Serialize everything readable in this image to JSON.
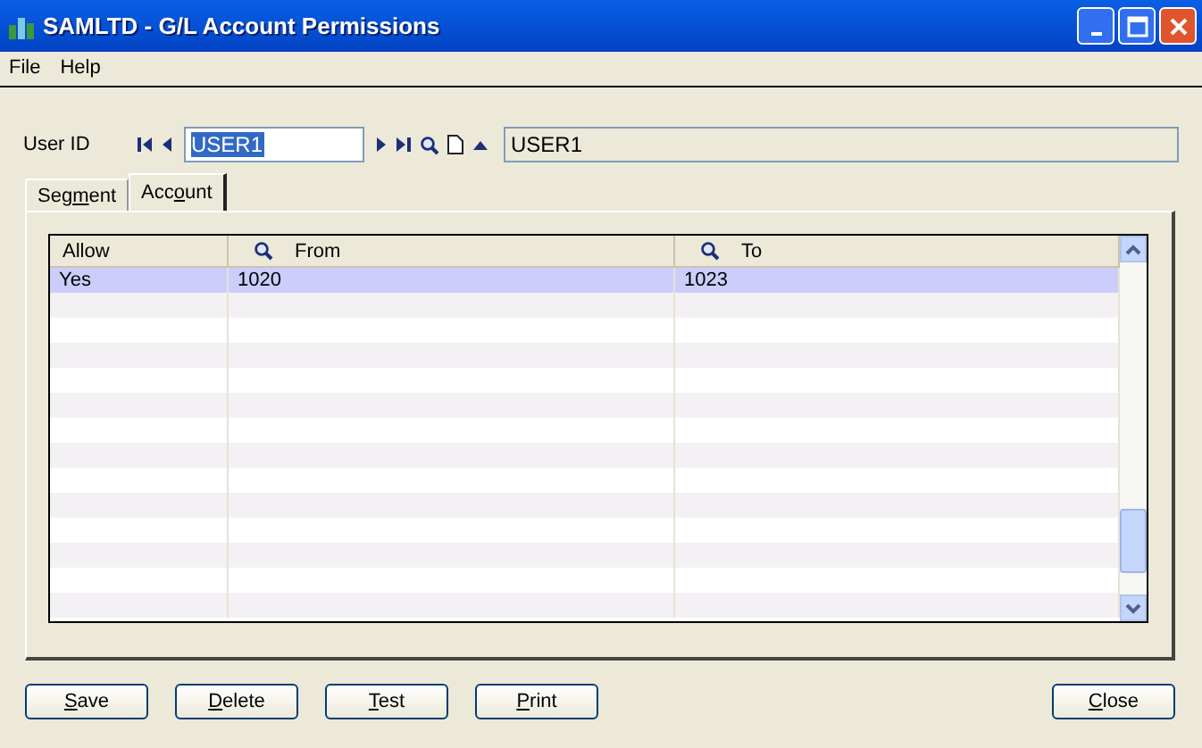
{
  "window": {
    "title": "SAMLTD - G/L Account Permissions"
  },
  "menu": [
    "File",
    "Help"
  ],
  "user_id": {
    "label": "User ID",
    "value": "USER1",
    "description": "USER1"
  },
  "tabs": [
    {
      "label_start": "Seg",
      "access_key": "m",
      "label_end": "ent",
      "selected": false
    },
    {
      "label_start": "Acc",
      "access_key": "o",
      "label_end": "unt",
      "selected": true
    }
  ],
  "table": {
    "columns": [
      {
        "label": "Allow",
        "finder": false
      },
      {
        "label": "From",
        "finder": true
      },
      {
        "label": "To",
        "finder": true
      }
    ],
    "rows": [
      {
        "cells": [
          "Yes",
          "1020",
          "1023"
        ],
        "selected": true
      }
    ]
  },
  "buttons": [
    {
      "access_key": "S",
      "label_end": "ave",
      "kind": "left"
    },
    {
      "access_key": "D",
      "label_end": "elete",
      "kind": "left"
    },
    {
      "access_key": "T",
      "label_end": "est",
      "kind": "left"
    },
    {
      "access_key": "P",
      "label_end": "rint",
      "kind": "left"
    },
    {
      "access_key": "C",
      "label_end": "lose",
      "kind": "right"
    }
  ]
}
